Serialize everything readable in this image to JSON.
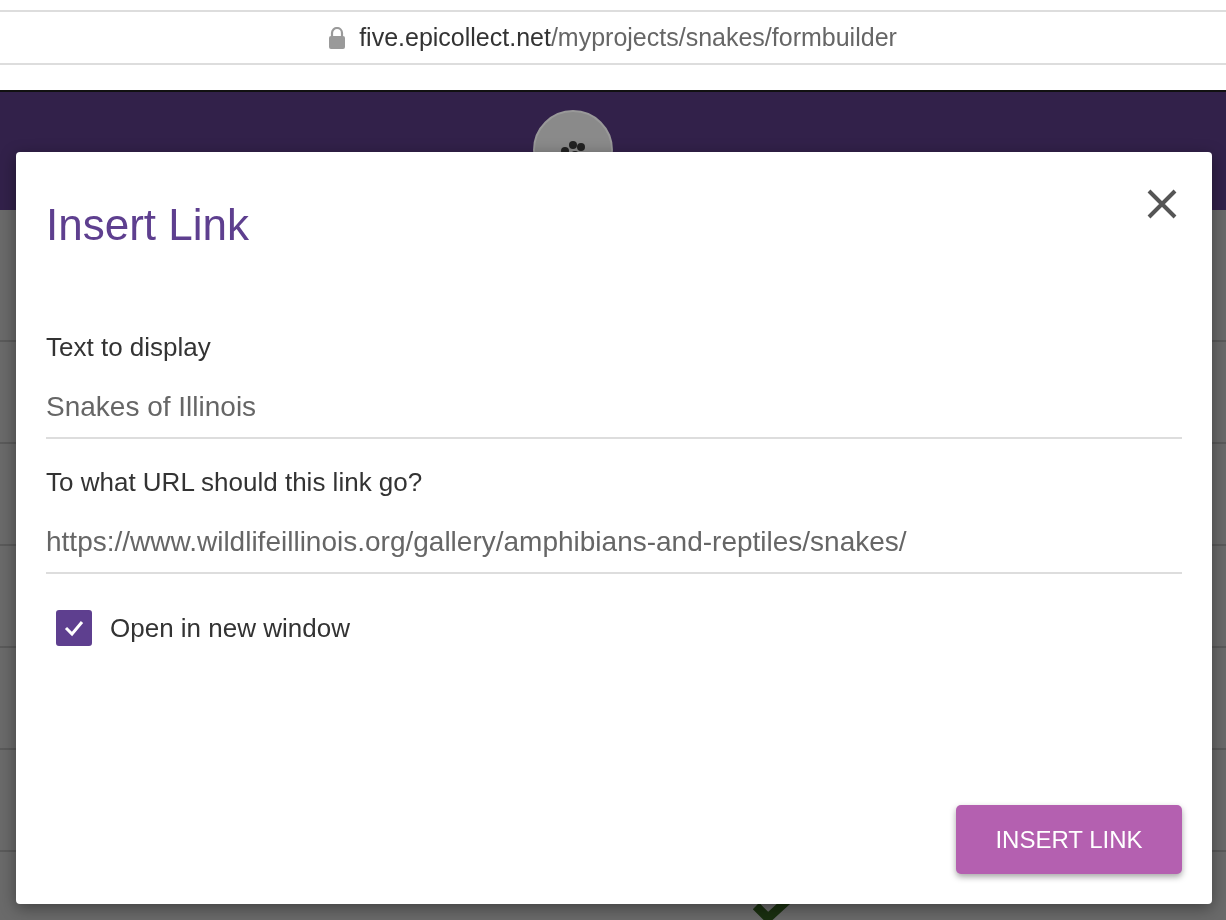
{
  "browser": {
    "url_host": "five.epicollect.net",
    "url_path": "/myprojects/snakes/formbuilder"
  },
  "dialog": {
    "title": "Insert Link",
    "fields": [
      {
        "label": "Text to display",
        "value": "Snakes of Illinois"
      },
      {
        "label": "To what URL should this link go?",
        "value": "https://www.wildlifeillinois.org/gallery/amphibians-and-reptiles/snakes/"
      }
    ],
    "open_in_new_window": {
      "label": "Open in new window",
      "checked": true
    },
    "button": "INSERT LINK"
  }
}
